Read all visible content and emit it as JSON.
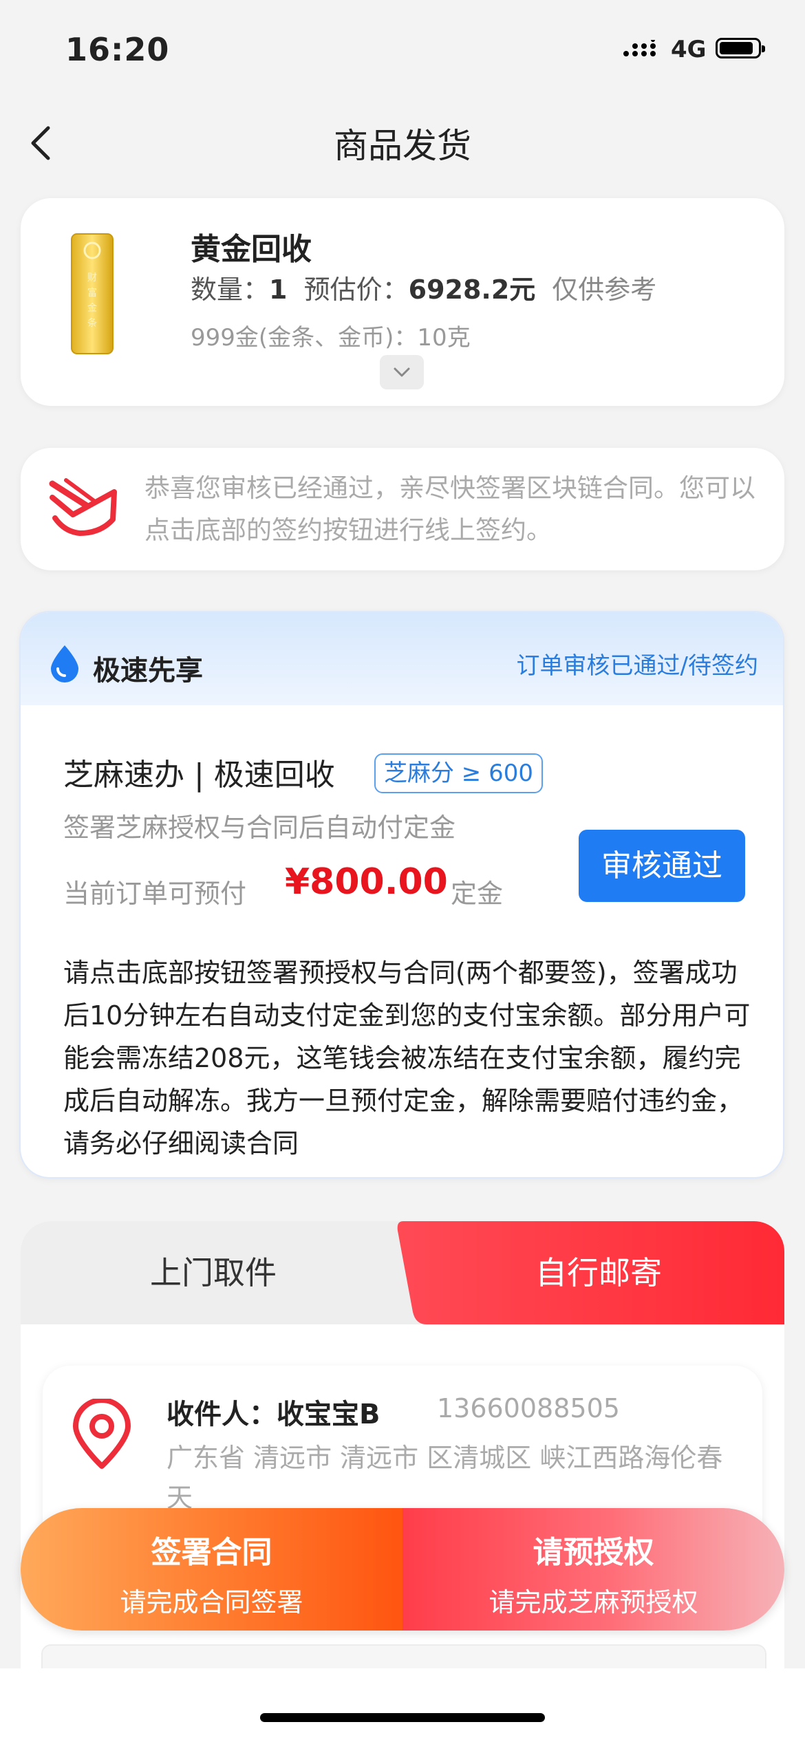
{
  "status_bar": {
    "time": "16:20",
    "network": "4G"
  },
  "nav": {
    "title": "商品发货"
  },
  "product": {
    "name": "黄金回收",
    "quantity_label": "数量：",
    "quantity": "1",
    "price_label": "预估价：",
    "price": "6928.2元",
    "price_note": "仅供参考",
    "spec": "999金(金条、金币)：10克",
    "image_text": "财富金条"
  },
  "notice": {
    "text": "恭喜您审核已经通过，亲尽快签署区块链合同。您可以点击底部的签约按钮进行线上签约。"
  },
  "fast": {
    "title": "极速先享",
    "status": "订单审核已通过/待签约",
    "service_title": "芝麻速办 | 极速回收",
    "credit_badge": "芝麻分 ≥ 600",
    "service_desc": "签署芝麻授权与合同后自动付定金",
    "prepay_label": "当前订单可预付",
    "prepay_amount": "¥800.00",
    "deposit_label": "定金",
    "review_button": "审核通过",
    "contract_note": "请点击底部按钮签署预授权与合同(两个都要签)，签署成功后10分钟左右自动支付定金到您的支付宝余额。部分用户可能会需冻结208元，这笔钱会被冻结在支付宝余额，履约完成后自动解冻。我方一旦预付定金，解除需要赔付违约金，请务必仔细阅读合同"
  },
  "delivery": {
    "tabs": [
      {
        "label": "上门取件"
      },
      {
        "label": "自行邮寄"
      }
    ],
    "recipient_label": "收件人：收宝宝B",
    "phone": "13660088505",
    "address": "广东省 清远市 清远市 区清城区 峡江西路海伦春天"
  },
  "actions": {
    "sign_contract": {
      "label": "签署合同",
      "sub": "请完成合同签署"
    },
    "pre_auth": {
      "label": "请预授权",
      "sub": "请完成芝麻预授权"
    }
  },
  "colors": {
    "accent_blue": "#1f7cf2",
    "price_red": "#e8141e",
    "tab_red": "#ff3b45",
    "orange": "#ff7a2d"
  }
}
